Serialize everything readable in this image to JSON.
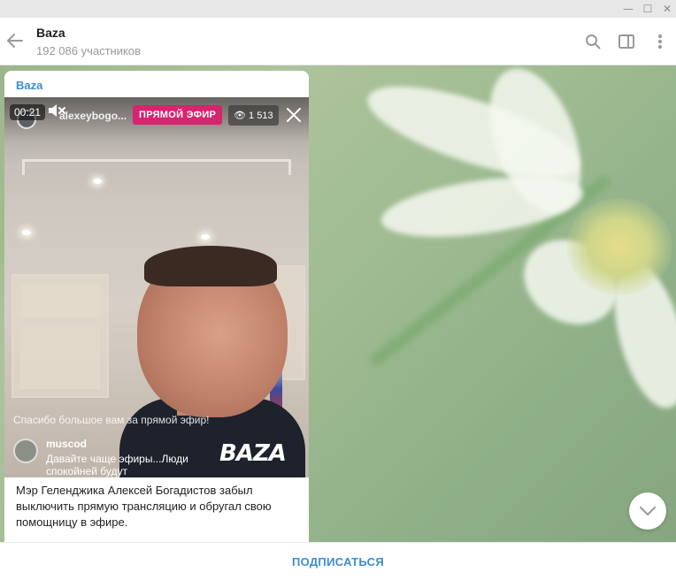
{
  "window": {
    "min_glyph": "—",
    "max_glyph": "☐",
    "close_glyph": "✕"
  },
  "header": {
    "title": "Baza",
    "subtitle": "192 086 участников",
    "icons": [
      "back-arrow-icon",
      "search-icon",
      "sidebar-panel-icon",
      "more-vertical-icon"
    ]
  },
  "message": {
    "author": "Baza",
    "video": {
      "time": "00:21",
      "username": "alexeybogo...",
      "live_label": "ПРЯМОЙ ЭФИР",
      "views": "1 513",
      "comment_system": "Спасибо большое вам за прямой эфир!",
      "comment_user": "muscod",
      "comment_text": "Давайте чаще эфиры...Люди спокойней будут",
      "watermark": "BAZA"
    },
    "caption": "Мэр Геленджика Алексей Богадистов забыл выключить прямую трансляцию и обругал свою помощницу в эфире."
  },
  "footer": {
    "subscribe_label": "ПОДПИСАТЬСЯ"
  },
  "colors": {
    "accent": "#3a8ed1",
    "live": "#d6246e"
  }
}
